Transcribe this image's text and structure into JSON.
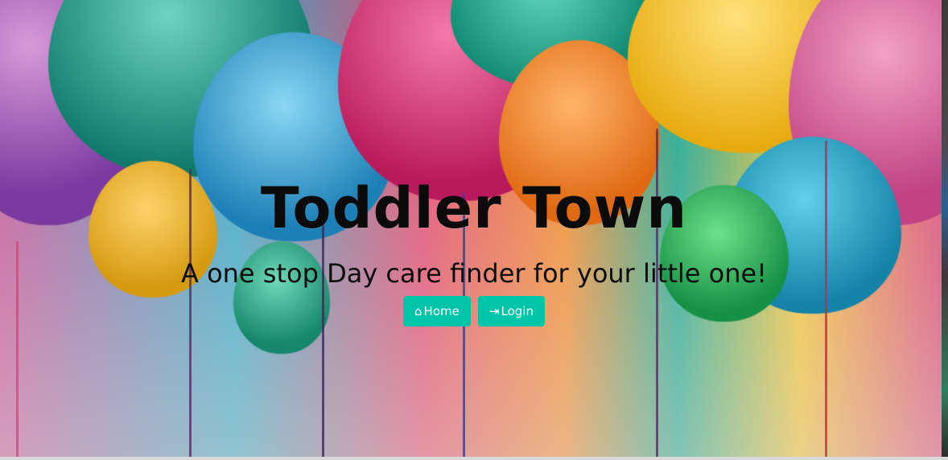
{
  "hero": {
    "title": "Toddler Town",
    "subtitle": "A one stop Day care finder for your little one!",
    "background": "balloons-photo"
  },
  "nav": {
    "buttons": [
      {
        "label": "Home",
        "icon": "home-icon"
      },
      {
        "label": "Login",
        "icon": "sign-in-icon"
      }
    ]
  },
  "colors": {
    "button_bg": "#00c4a7",
    "button_text": "#ffffff",
    "title_text": "#0b0b0b"
  }
}
